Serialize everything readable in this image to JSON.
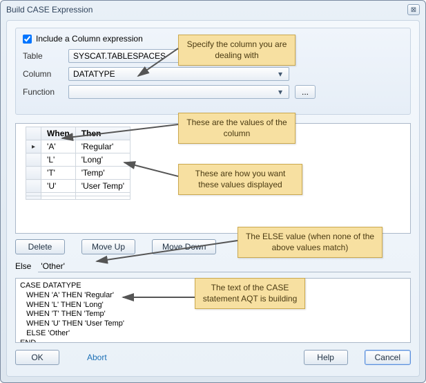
{
  "window": {
    "title": "Build CASE Expression",
    "close_glyph": "⊠"
  },
  "include": {
    "checked": true,
    "label": "Include a Column expression"
  },
  "fields": {
    "table_label": "Table",
    "table_value": "SYSCAT.TABLESPACES",
    "column_label": "Column",
    "column_value": "DATATYPE",
    "function_label": "Function",
    "function_value": "",
    "func_button_label": "..."
  },
  "grid": {
    "headers": {
      "when": "When",
      "then": "Then"
    },
    "rows": [
      {
        "when": "'A'",
        "then": "'Regular'"
      },
      {
        "when": "'L'",
        "then": "'Long'"
      },
      {
        "when": "'T'",
        "then": "'Temp'"
      },
      {
        "when": "'U'",
        "then": "'User Temp'"
      }
    ],
    "selected_row_marker": "▸"
  },
  "grid_buttons": {
    "delete": "Delete",
    "moveup": "Move Up",
    "movedown": "Move Down"
  },
  "else": {
    "label": "Else",
    "value": "'Other'"
  },
  "preview": {
    "text": "CASE DATATYPE\n   WHEN 'A' THEN 'Regular'\n   WHEN 'L' THEN 'Long'\n   WHEN 'T' THEN 'Temp'\n   WHEN 'U' THEN 'User Temp'\n   ELSE 'Other'\nEND"
  },
  "dialog_buttons": {
    "ok": "OK",
    "abort": "Abort",
    "help": "Help",
    "cancel": "Cancel"
  },
  "callouts": {
    "c1": "Specify the column you\nare dealing with",
    "c2": "These are the values of\nthe column",
    "c3": "These are how you want\nthese values displayed",
    "c4": "The ELSE value (when none of\nthe above values match)",
    "c5": "The text of the CASE\nstatement AQT is\nbuilding"
  }
}
